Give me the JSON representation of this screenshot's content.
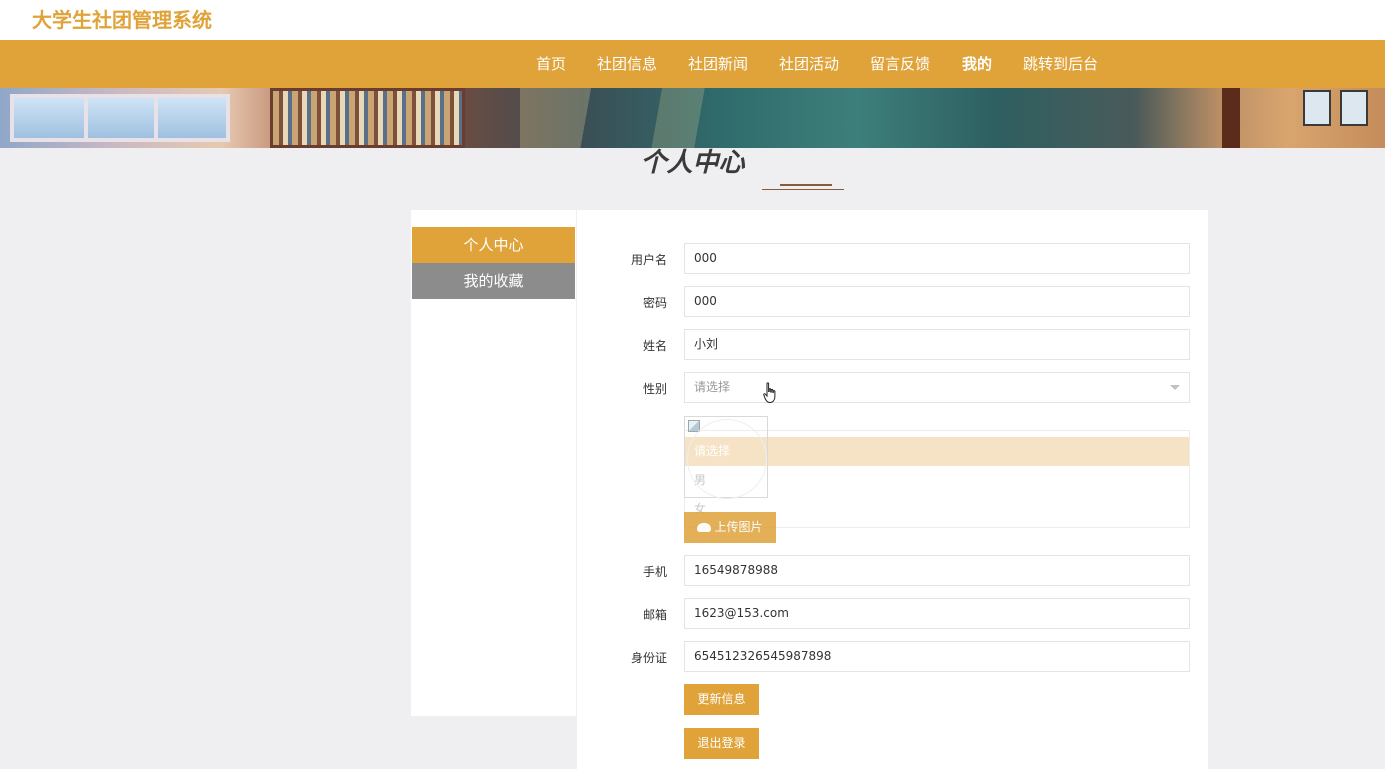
{
  "site": {
    "title": "大学生社团管理系统"
  },
  "nav": {
    "items": [
      {
        "label": "首页"
      },
      {
        "label": "社团信息"
      },
      {
        "label": "社团新闻"
      },
      {
        "label": "社团活动"
      },
      {
        "label": "留言反馈"
      },
      {
        "label": "我的"
      },
      {
        "label": "跳转到后台"
      }
    ],
    "active_label": "我的"
  },
  "page": {
    "title": "个人中心"
  },
  "sidebar": {
    "items": [
      {
        "label": "个人中心"
      },
      {
        "label": "我的收藏"
      }
    ]
  },
  "form": {
    "username": {
      "label": "用户名",
      "value": "000"
    },
    "password": {
      "label": "密码",
      "value": "000"
    },
    "name": {
      "label": "姓名",
      "value": "小刘"
    },
    "gender": {
      "label": "性别",
      "placeholder": "请选择",
      "options": [
        "请选择",
        "男",
        "女"
      ]
    },
    "upload_label": "上传图片",
    "phone": {
      "label": "手机",
      "value": "16549878988"
    },
    "email": {
      "label": "邮箱",
      "value": "1623@153.com"
    },
    "idcard": {
      "label": "身份证",
      "value": "654512326545987898"
    },
    "update_label": "更新信息",
    "logout_label": "退出登录"
  },
  "colors": {
    "accent": "#dfa33a",
    "sidebar_inactive": "#8c8c8c",
    "background": "#efeff2"
  }
}
